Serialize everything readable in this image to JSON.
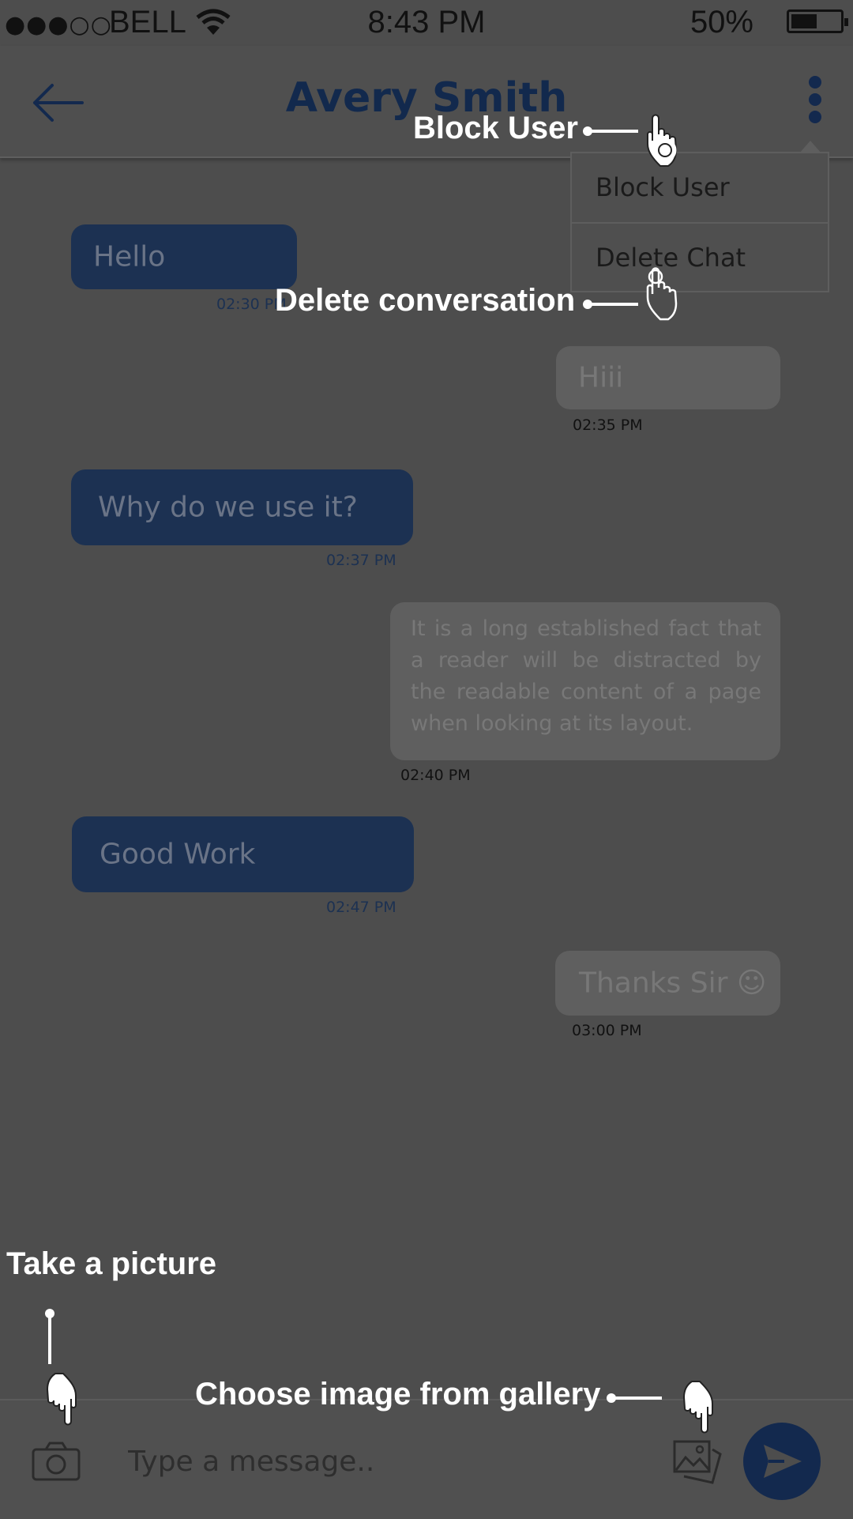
{
  "status_bar": {
    "signal": "●●●○○",
    "carrier": "BELL",
    "time": "8:43 PM",
    "battery": "50%",
    "battery_level": 0.5
  },
  "header": {
    "title": "Avery Smith"
  },
  "menu": {
    "items": [
      "Block User",
      "Delete Chat"
    ]
  },
  "messages": [
    {
      "side": "in",
      "text": "Hello",
      "time": "02:30 PM"
    },
    {
      "side": "out",
      "text": "Hiii",
      "time": "02:35 PM"
    },
    {
      "side": "in",
      "text": "Why do we use it?",
      "time": "02:37 PM"
    },
    {
      "side": "out",
      "text": "It is a long established fact that a reader will be distracted by the readable content of a page when looking at its layout.",
      "time": "02:40 PM"
    },
    {
      "side": "in",
      "text": "Good Work",
      "time": "02:47 PM"
    },
    {
      "side": "out",
      "text": "Thanks Sir ☺",
      "time": "03:00 PM"
    }
  ],
  "composer": {
    "placeholder": "Type a message.."
  },
  "annotations": {
    "block_user": "Block User",
    "delete_conversation": "Delete conversation",
    "take_picture": "Take a picture",
    "choose_gallery": "Choose image from gallery"
  },
  "colors": {
    "accent": "#13294e",
    "overlay": "#4d4d4d"
  }
}
